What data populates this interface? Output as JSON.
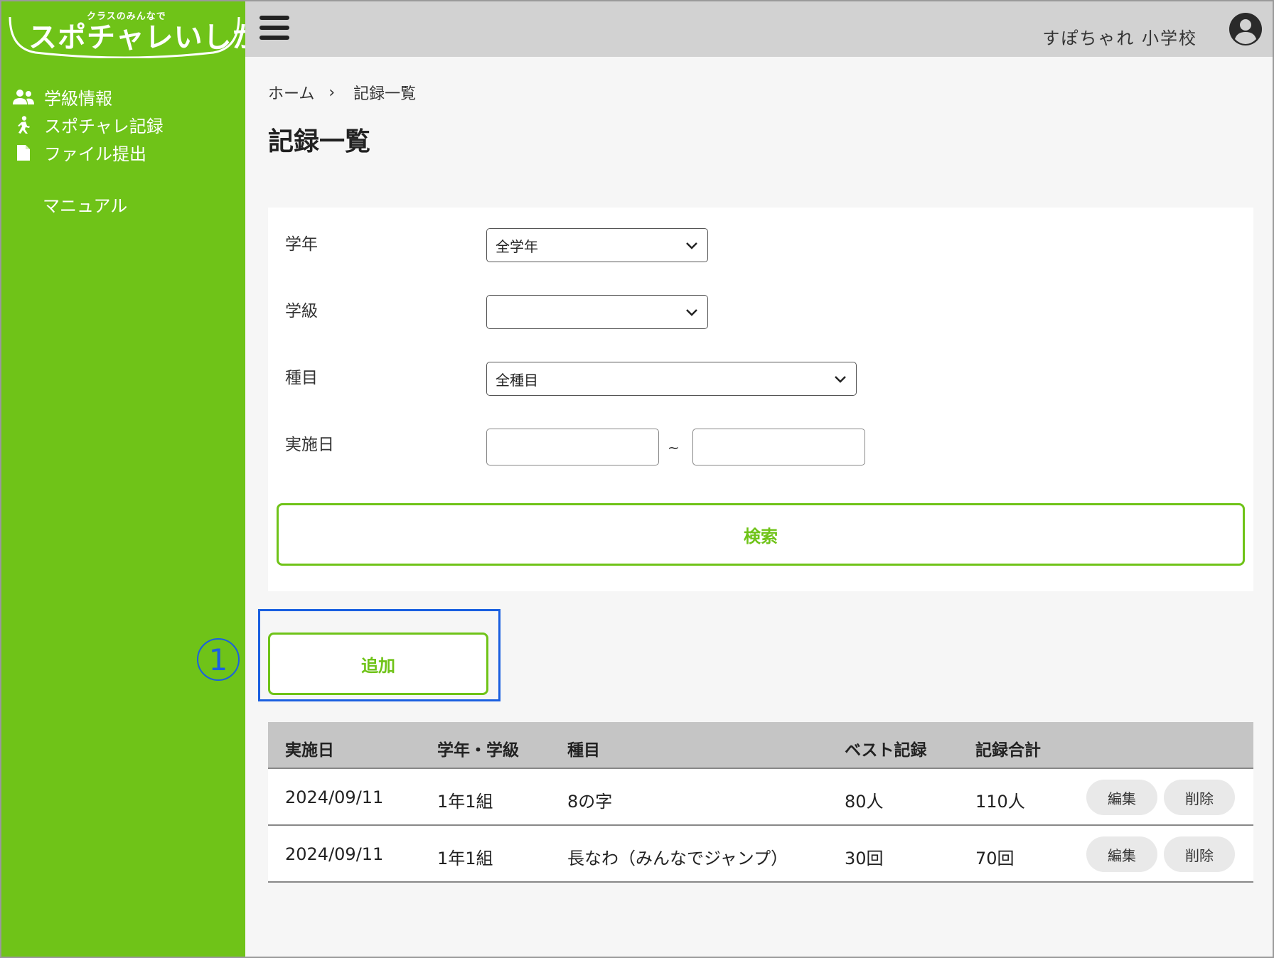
{
  "logo": {
    "subtitle": "クラスのみんなで",
    "title": "スポチャレいしかわ"
  },
  "sidebar": {
    "items": [
      {
        "label": "学級情報",
        "icon": "users-icon"
      },
      {
        "label": "スポチャレ記録",
        "icon": "walking-person-icon"
      },
      {
        "label": "ファイル提出",
        "icon": "file-icon"
      }
    ],
    "manual": "マニュアル"
  },
  "header": {
    "school": "すぽちゃれ 小学校"
  },
  "breadcrumb": {
    "home": "ホーム",
    "separator": "›",
    "current": "記録一覧"
  },
  "page_title": "記録一覧",
  "form": {
    "grade_label": "学年",
    "grade_value": "全学年",
    "class_label": "学級",
    "class_value": "",
    "event_label": "種目",
    "event_value": "全種目",
    "date_label": "実施日",
    "date_separator": "~",
    "search_button": "検索"
  },
  "add_button": "追加",
  "callout_number": "1",
  "table": {
    "headers": [
      "実施日",
      "学年・学級",
      "種目",
      "ベスト記録",
      "記録合計"
    ],
    "rows": [
      {
        "date": "2024/09/11",
        "class": "1年1組",
        "event": "8の字",
        "best": "80人",
        "total": "110人"
      },
      {
        "date": "2024/09/11",
        "class": "1年1組",
        "event": "長なわ（みんなでジャンプ）",
        "best": "30回",
        "total": "70回"
      }
    ],
    "edit_label": "編集",
    "delete_label": "削除"
  },
  "colors": {
    "brand_green": "#6fc318",
    "callout_blue": "#1a5fe0",
    "header_gray": "#d2d2d2"
  }
}
